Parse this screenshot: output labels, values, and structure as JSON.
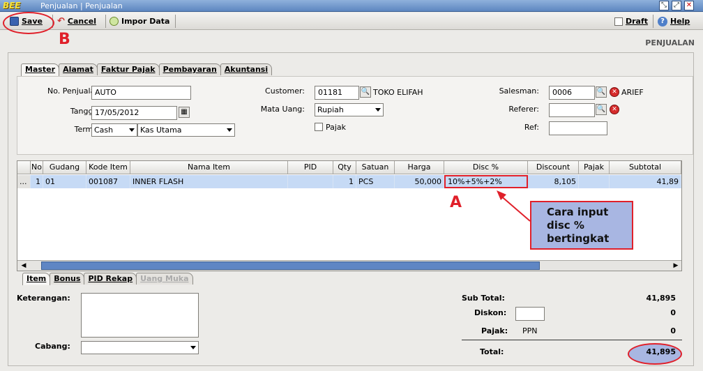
{
  "window": {
    "title": "Penjualan | Penjualan",
    "logo": "BEE"
  },
  "toolbar": {
    "save": "Save",
    "cancel": "Cancel",
    "impor": "Impor Data",
    "draft": "Draft",
    "help": "Help"
  },
  "page": {
    "heading": "PENJUALAN"
  },
  "tabs": [
    "Master",
    "Alamat",
    "Faktur Pajak",
    "Pembayaran",
    "Akuntansi"
  ],
  "form": {
    "no_label": "No. Penjualan:",
    "no_value": "AUTO",
    "tanggal_label": "Tanggal:",
    "tanggal_value": "17/05/2012",
    "termin_label": "Termin:",
    "termin_value": "Cash",
    "kas_value": "Kas Utama",
    "customer_label": "Customer:",
    "customer_code": "01181",
    "customer_name": "TOKO ELIFAH",
    "matauang_label": "Mata Uang:",
    "matauang_value": "Rupiah",
    "pajak_label": "Pajak",
    "salesman_label": "Salesman:",
    "salesman_code": "0006",
    "salesman_name": "ARIEF",
    "referer_label": "Referer:",
    "ref_label": "Ref:"
  },
  "grid": {
    "headers": [
      "No",
      "Gudang",
      "Kode Item",
      "Nama Item",
      "PID",
      "Qty",
      "Satuan",
      "Harga",
      "Disc %",
      "Discount",
      "Pajak",
      "Subtotal"
    ],
    "row": {
      "marker": "...",
      "no": "1",
      "gudang": "01",
      "kode": "001087",
      "nama": "INNER FLASH",
      "pid": "",
      "qty": "1",
      "satuan": "PCS",
      "harga": "50,000",
      "disc": "10%+5%+2%",
      "discount": "8,105",
      "pajak": "",
      "subtotal": "41,89"
    }
  },
  "bottom_tabs": [
    "Item",
    "Bonus",
    "PID Rekap",
    "Uang Muka"
  ],
  "bottom": {
    "keterangan_label": "Keterangan:",
    "cabang_label": "Cabang:"
  },
  "totals": {
    "subtotal_label": "Sub Total:",
    "subtotal_value": "41,895",
    "diskon_label": "Diskon:",
    "diskon_value": "0",
    "pajak_label": "Pajak:",
    "pajak_type": "PPN",
    "pajak_value": "0",
    "total_label": "Total:",
    "total_value": "41,895"
  },
  "annotations": {
    "a": "A",
    "b": "B",
    "callout": "Cara input disc % bertingkat"
  },
  "colors": {
    "annotation": "#e0202a",
    "selected_row": "#c6daf5",
    "callout_bg": "#a8b6e2"
  }
}
